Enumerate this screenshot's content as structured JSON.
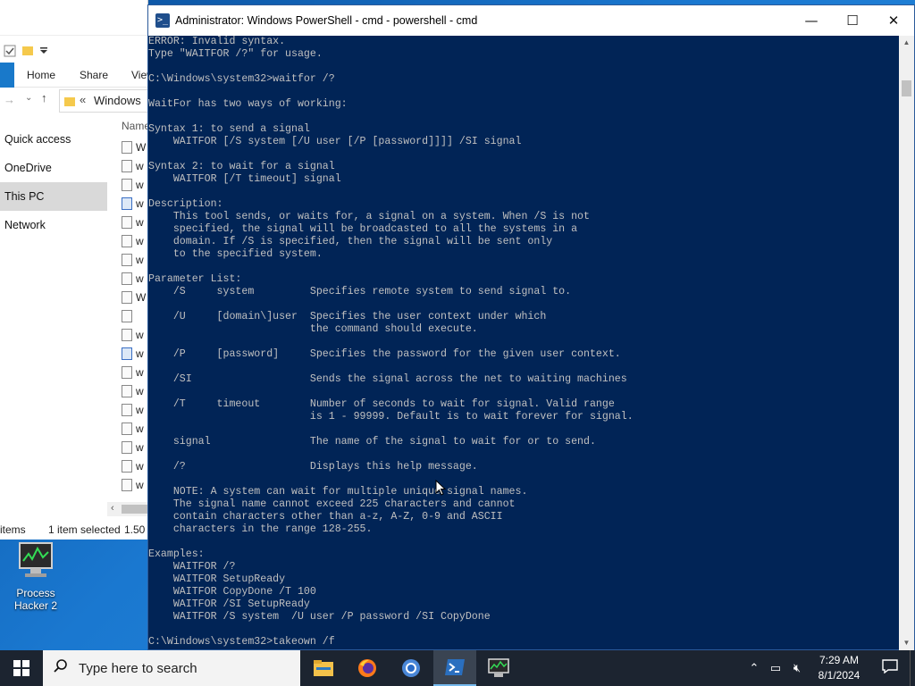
{
  "desktop": {
    "icons": [
      {
        "name": "this-pc",
        "label": ""
      },
      {
        "name": "process-hacker",
        "label": "Process Hacker 2"
      }
    ]
  },
  "explorer": {
    "ribbon_tabs": [
      "Home",
      "Share",
      "View"
    ],
    "address": "Windows",
    "address_prefix": "«",
    "column_header": "Name",
    "nav": [
      "Quick access",
      "OneDrive",
      "This PC",
      "Network"
    ],
    "selected_nav": "This PC",
    "file_letters": [
      "W",
      "w",
      "w",
      "w",
      "w",
      "w",
      "w",
      "w",
      "W",
      "",
      "w",
      "w",
      "w",
      "w",
      "w",
      "w",
      "w",
      "w",
      "w"
    ],
    "status_items": "items",
    "status_selected": "1 item selected",
    "status_size": "1.50"
  },
  "powershell": {
    "title": "Administrator: Windows PowerShell - cmd - powershell - cmd",
    "controls": {
      "minimize": "—",
      "maximize": "☐",
      "close": "✕"
    },
    "lines": [
      "ERROR: Invalid syntax.",
      "Type \"WAITFOR /?\" for usage.",
      "",
      "C:\\Windows\\system32>waitfor /?",
      "",
      "WaitFor has two ways of working:",
      "",
      "Syntax 1: to send a signal",
      "    WAITFOR [/S system [/U user [/P [password]]]] /SI signal",
      "",
      "Syntax 2: to wait for a signal",
      "    WAITFOR [/T timeout] signal",
      "",
      "Description:",
      "    This tool sends, or waits for, a signal on a system. When /S is not",
      "    specified, the signal will be broadcasted to all the systems in a",
      "    domain. If /S is specified, then the signal will be sent only",
      "    to the specified system.",
      "",
      "Parameter List:",
      "    /S     system         Specifies remote system to send signal to.",
      "",
      "    /U     [domain\\]user  Specifies the user context under which",
      "                          the command should execute.",
      "",
      "    /P     [password]     Specifies the password for the given user context.",
      "",
      "    /SI                   Sends the signal across the net to waiting machines",
      "",
      "    /T     timeout        Number of seconds to wait for signal. Valid range",
      "                          is 1 - 99999. Default is to wait forever for signal.",
      "",
      "    signal                The name of the signal to wait for or to send.",
      "",
      "    /?                    Displays this help message.",
      "",
      "    NOTE: A system can wait for multiple unique signal names.",
      "    The signal name cannot exceed 225 characters and cannot",
      "    contain characters other than a-z, A-Z, 0-9 and ASCII",
      "    characters in the range 128-255.",
      "",
      "Examples:",
      "    WAITFOR /?",
      "    WAITFOR SetupReady",
      "    WAITFOR CopyDone /T 100",
      "    WAITFOR /SI SetupReady",
      "    WAITFOR /S system  /U user /P password /SI CopyDone",
      "",
      "C:\\Windows\\system32>takeown /f"
    ]
  },
  "taskbar": {
    "search_placeholder": "Type here to search",
    "apps": [
      "file-explorer",
      "firefox",
      "chrome",
      "powershell",
      "process-hacker"
    ],
    "active_app": "powershell",
    "time": "7:29 AM",
    "date": "8/1/2024"
  },
  "colors": {
    "console_bg": "#012456",
    "console_fg": "#c0c0c0",
    "taskbar_bg": "#1c2430",
    "desktop_blue": "#1976c8"
  }
}
